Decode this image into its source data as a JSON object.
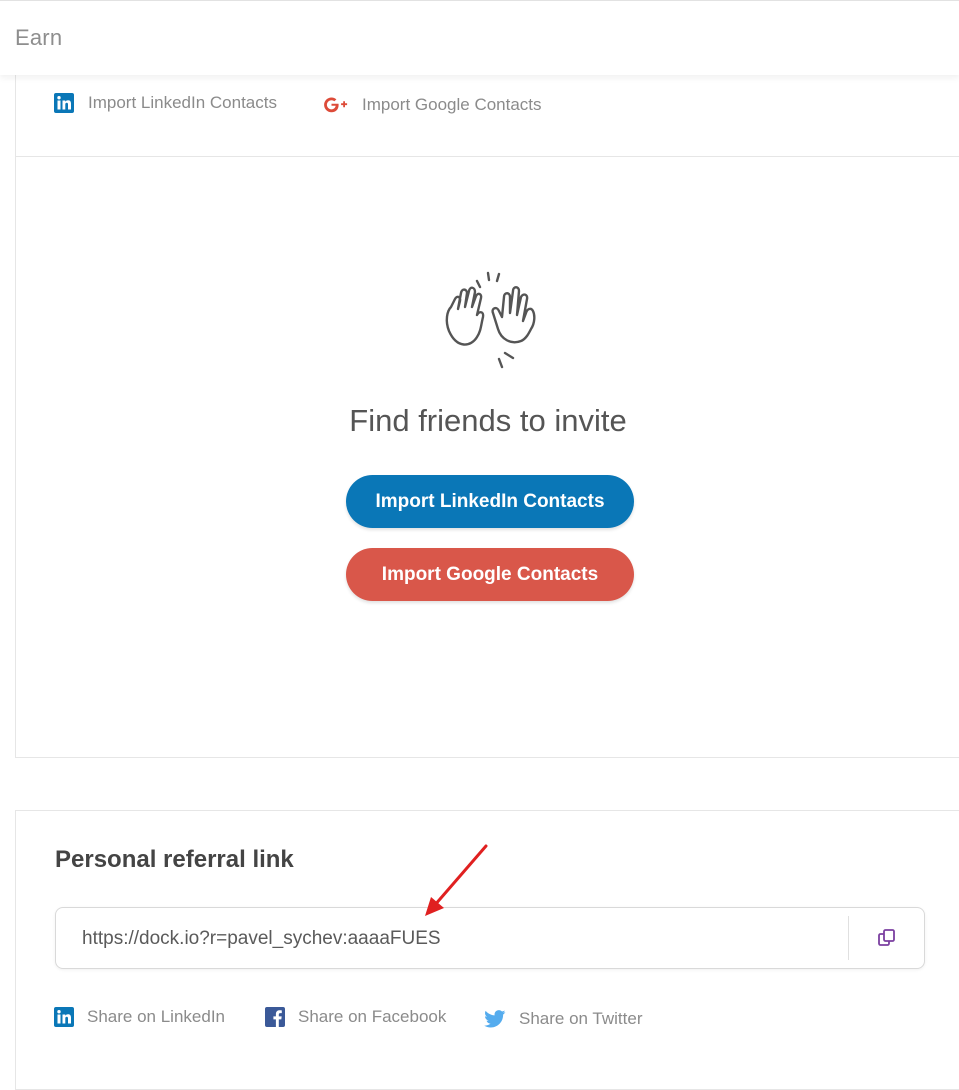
{
  "header": {
    "title": "Earn"
  },
  "import_tabs": {
    "linkedin_label": "Import LinkedIn Contacts",
    "google_label": "Import Google Contacts"
  },
  "invite": {
    "heading": "Find friends to invite",
    "linkedin_button": "Import LinkedIn Contacts",
    "google_button": "Import Google Contacts"
  },
  "referral": {
    "title": "Personal referral link",
    "link_value": "https://dock.io?r=pavel_sychev:aaaaFUES",
    "share": {
      "linkedin": "Share on LinkedIn",
      "facebook": "Share on Facebook",
      "twitter": "Share on Twitter"
    }
  },
  "icons": {
    "linkedin": "linkedin-icon",
    "google": "google-plus-icon",
    "high_five": "high-five-icon",
    "copy": "copy-icon",
    "facebook": "facebook-icon",
    "twitter": "twitter-icon",
    "annotation": "red-arrow-annotation"
  },
  "colors": {
    "linkedin": "#0a77b7",
    "google": "#d9574a",
    "facebook": "#3b5998",
    "twitter": "#55acee",
    "copy_icon": "#7b3fa0",
    "annotation": "#e02020"
  }
}
